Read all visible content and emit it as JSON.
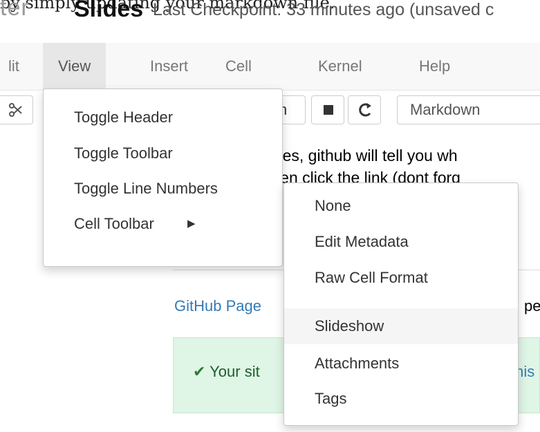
{
  "header": {
    "top_text": "by simply updating your markdown file.",
    "logo_text": "ter",
    "notebook_title": "Slides",
    "checkpoint": "Last Checkpoint: 33 minutes ago  (unsaved c"
  },
  "menubar": {
    "items": [
      "lit",
      "View",
      "Insert",
      "Cell",
      "Kernel",
      "Help"
    ],
    "active": "View"
  },
  "toolbar": {
    "cell_type": "Markdown",
    "partial_label": "n"
  },
  "view_menu": {
    "items": [
      "Toggle Header",
      "Toggle Toolbar",
      "Toggle Line Numbers",
      "Cell Toolbar"
    ]
  },
  "cell_toolbar_menu": {
    "items": [
      "None",
      "Edit Metadata",
      "Raw Cell Format",
      "Slideshow",
      "Attachments",
      "Tags"
    ],
    "highlighted": "Slideshow"
  },
  "content": {
    "line1": "nges, github will tell you wh",
    "line2": "then click the link (dont forg",
    "link": "GitHub Page",
    "link_after": "pe",
    "success": "Your sit",
    "success_after": "mis"
  },
  "colors": {
    "menubar_bg": "#f8f8f8",
    "active_menu_bg": "#e7e7e7",
    "highlight_bg": "#f5f5f5",
    "link": "#337ab7",
    "success_bg": "#dff5e6"
  }
}
